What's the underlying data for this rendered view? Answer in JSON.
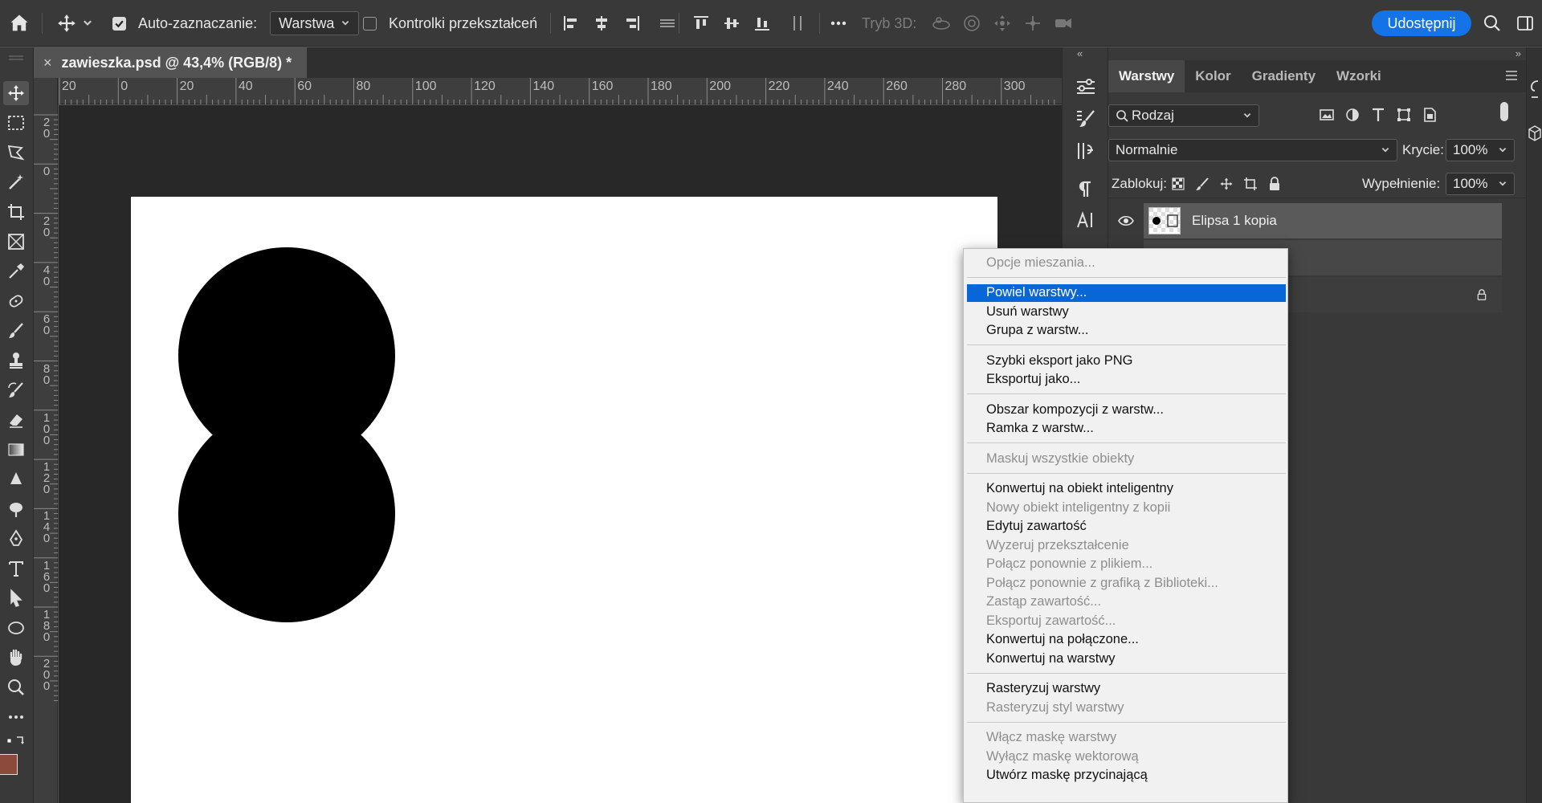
{
  "options_bar": {
    "auto_select_label": "Auto-zaznaczanie:",
    "auto_select_checked": true,
    "auto_select_target": "Warstwa",
    "transform_controls_label": "Kontrolki przekształceń",
    "transform_controls_checked": false,
    "mode_3d_label": "Tryb 3D:",
    "share_label": "Udostępnij"
  },
  "document_tab": {
    "title": "zawieszka.psd @ 43,4% (RGB/8) *"
  },
  "rulers": {
    "horizontal_labels": [
      "20",
      "0",
      "20",
      "40",
      "60",
      "80",
      "100",
      "120",
      "140",
      "160",
      "180",
      "200",
      "220",
      "240",
      "260",
      "280",
      "300"
    ],
    "vertical_labels": [
      "20",
      "0",
      "20",
      "40",
      "60",
      "80",
      "100",
      "120",
      "140",
      "160",
      "180",
      "200"
    ]
  },
  "colors": {
    "foreground": "#8b4a3c",
    "background": "#ffffff",
    "accent": "#1473e6",
    "menu_highlight": "#0867d8"
  },
  "layers_panel": {
    "tabs": [
      "Warstwy",
      "Kolor",
      "Gradienty",
      "Wzorki"
    ],
    "active_tab": "Warstwy",
    "filter_kind": "Rodzaj",
    "blend_mode": "Normalnie",
    "opacity_label": "Krycie:",
    "opacity_value": "100%",
    "lock_label": "Zablokuj:",
    "fill_label": "Wypełnienie:",
    "fill_value": "100%",
    "layers": [
      {
        "name": "Elipsa 1 kopia",
        "visible": true,
        "selected": true
      }
    ]
  },
  "context_menu": {
    "groups": [
      [
        {
          "label": "Opcje mieszania...",
          "enabled": false
        }
      ],
      [
        {
          "label": "Powiel warstwy...",
          "enabled": true,
          "highlighted": true
        },
        {
          "label": "Usuń warstwy",
          "enabled": true
        },
        {
          "label": "Grupa z warstw...",
          "enabled": true
        }
      ],
      [
        {
          "label": "Szybki eksport jako PNG",
          "enabled": true
        },
        {
          "label": "Eksportuj jako...",
          "enabled": true
        }
      ],
      [
        {
          "label": "Obszar kompozycji z warstw...",
          "enabled": true
        },
        {
          "label": "Ramka z warstw...",
          "enabled": true
        }
      ],
      [
        {
          "label": "Maskuj wszystkie obiekty",
          "enabled": false
        }
      ],
      [
        {
          "label": "Konwertuj na obiekt inteligentny",
          "enabled": true
        },
        {
          "label": "Nowy obiekt inteligentny z kopii",
          "enabled": false
        },
        {
          "label": "Edytuj zawartość",
          "enabled": true
        },
        {
          "label": "Wyzeruj przekształcenie",
          "enabled": false
        },
        {
          "label": "Połącz ponownie z plikiem...",
          "enabled": false
        },
        {
          "label": "Połącz ponownie z grafiką z Biblioteki...",
          "enabled": false
        },
        {
          "label": "Zastąp zawartość...",
          "enabled": false
        },
        {
          "label": "Eksportuj zawartość...",
          "enabled": false
        },
        {
          "label": "Konwertuj na połączone...",
          "enabled": true
        },
        {
          "label": "Konwertuj na warstwy",
          "enabled": true
        }
      ],
      [
        {
          "label": "Rasteryzuj warstwy",
          "enabled": true
        },
        {
          "label": "Rasteryzuj styl warstwy",
          "enabled": false
        }
      ],
      [
        {
          "label": "Włącz maskę warstwy",
          "enabled": false
        },
        {
          "label": "Wyłącz maskę wektorową",
          "enabled": false
        },
        {
          "label": "Utwórz maskę przycinającą",
          "enabled": true
        }
      ]
    ]
  }
}
